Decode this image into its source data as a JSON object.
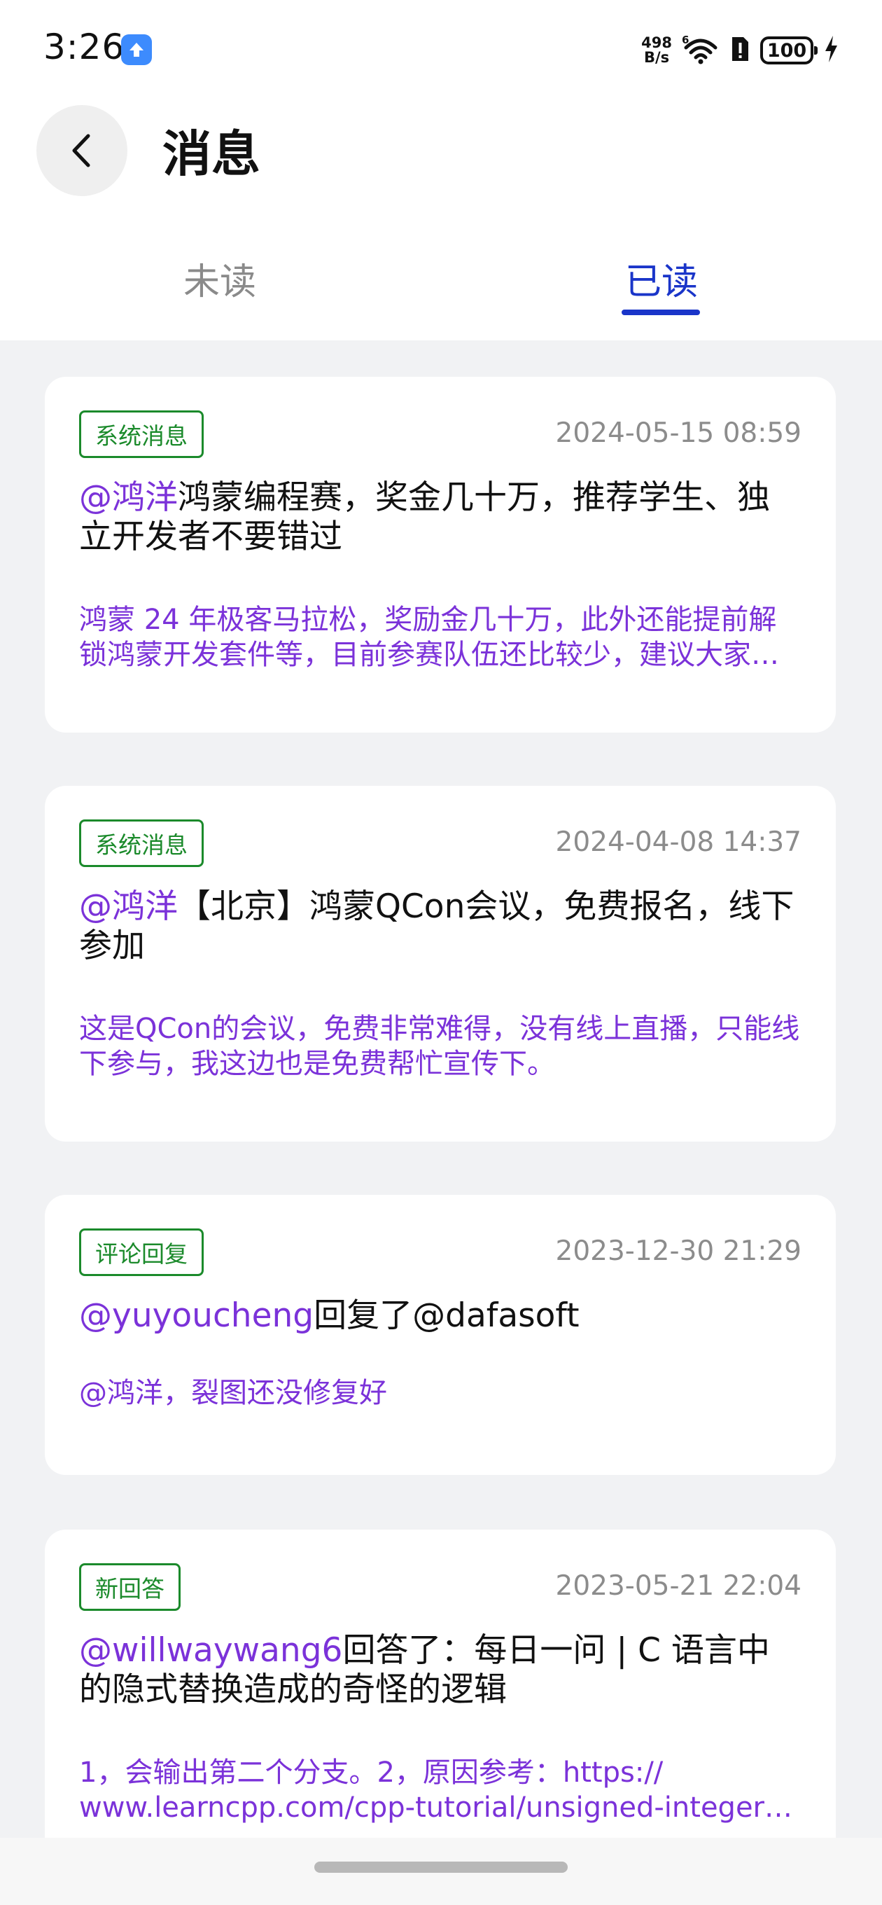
{
  "status_bar": {
    "time": "3:26",
    "net_speed_value": "498",
    "net_speed_unit": "B/s",
    "battery": "100",
    "app_icon": "upload-arrow-icon",
    "icons": [
      "wifi-6-icon",
      "sim-alert-icon",
      "battery-icon",
      "charging-bolt-icon"
    ]
  },
  "header": {
    "title": "消息",
    "back_icon": "chevron-left-icon"
  },
  "tabs": [
    {
      "label": "未读",
      "active": false
    },
    {
      "label": "已读",
      "active": true
    }
  ],
  "colors": {
    "accent": "#1a35c9",
    "badge_green": "#1b8a2b",
    "mention_purple": "#7b32d9",
    "background": "#f1f2f4"
  },
  "messages": [
    {
      "badge": "系统消息",
      "time": "2024-05-15 08:59",
      "mention": "@鸿洋",
      "text": "鸿蒙编程赛，奖金几十万，推荐学生、独立开发者不要错过",
      "preview": "鸿蒙 24 年极客马拉松，奖励金几十万，此外还能提前解锁鸿蒙开发套件等，目前参赛队伍还比较少，建议大家抓紧报名参与"
    },
    {
      "badge": "系统消息",
      "time": "2024-04-08 14:37",
      "mention": "@鸿洋",
      "text": "【北京】鸿蒙QCon会议，免费报名，线下参加",
      "preview": "这是QCon的会议，免费非常难得，没有线上直播，只能线下参与，我这边也是免费帮忙宣传下。"
    },
    {
      "badge": "评论回复",
      "time": "2023-12-30 21:29",
      "mention": "@yuyoucheng",
      "text": "回复了@dafasoft",
      "preview": "@鸿洋，裂图还没修复好"
    },
    {
      "badge": "新回答",
      "time": "2023-05-21 22:04",
      "mention": "@willwaywang6",
      "text": "回答了：每日一问 | C 语言中的隐式替换造成的奇怪的逻辑",
      "preview": "1，会输出第二个分支。2，原因参考：https:// www.learncpp.com/cpp-tutorial/unsigned-integers-and-why-to-avoid-them/"
    }
  ]
}
